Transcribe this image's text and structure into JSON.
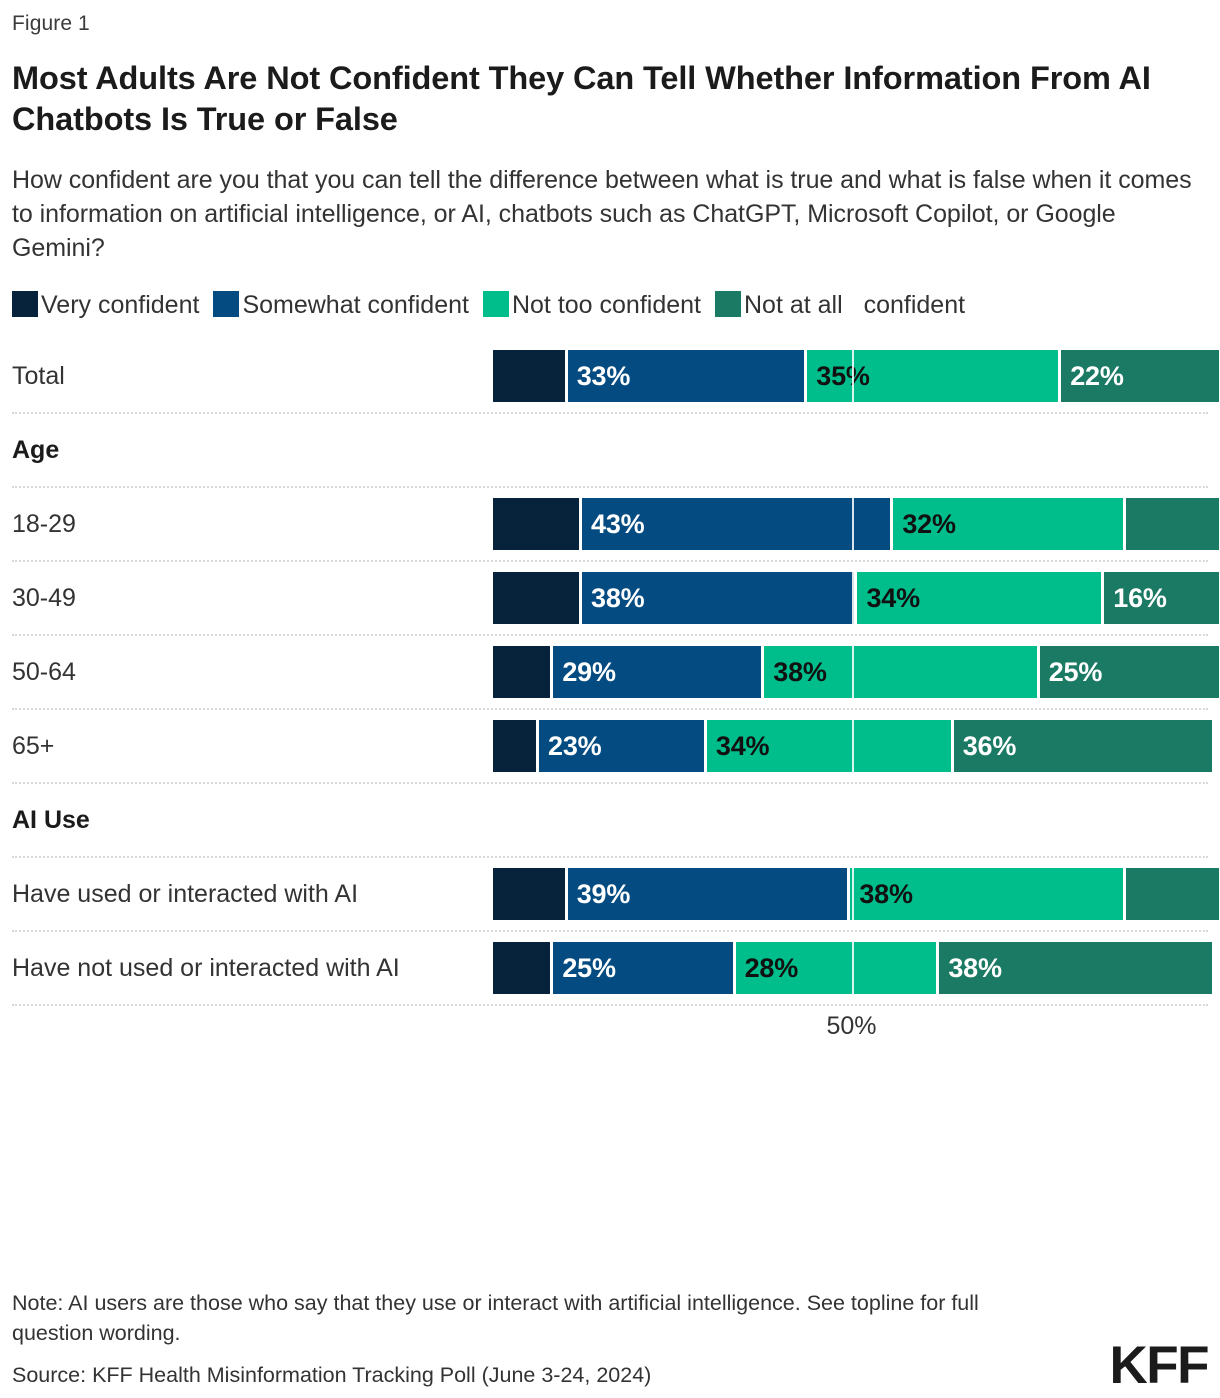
{
  "figure_label": "Figure 1",
  "title": "Most Adults Are Not Confident They Can Tell Whether Information From AI Chatbots Is True or False",
  "subtitle": "How confident are you that you can tell the difference between what is true and what is false when it comes to information on artificial intelligence, or AI, chatbots such as ChatGPT, Microsoft Copilot, or Google Gemini?",
  "legend": [
    {
      "label": "Very confident",
      "color": "#07233c"
    },
    {
      "label": "Somewhat confident",
      "color": "#034b81"
    },
    {
      "label": "Not too confident",
      "color": "#00bd8c"
    },
    {
      "label": "Not at all confident",
      "color": "#1a7a63"
    }
  ],
  "axis": {
    "tick_label": "50%",
    "tick_value": 50
  },
  "footer": {
    "note": "Note: AI users are those who say that they use or interact with artificial intelligence. See topline for full question wording.",
    "source": "Source: KFF Health Misinformation Tracking Poll (June 3-24, 2024)",
    "logo": "KFF"
  },
  "chart_data": {
    "type": "bar",
    "orientation": "horizontal",
    "stacked": true,
    "percent": true,
    "title": "Most Adults Are Not Confident They Can Tell Whether Information From AI Chatbots Is True or False",
    "subtitle": "How confident are you that you can tell the difference between what is true and what is false when it comes to information on artificial intelligence, or AI, chatbots such as ChatGPT, Microsoft Copilot, or Google Gemini?",
    "xlabel": "",
    "ylabel": "",
    "xlim": [
      0,
      100
    ],
    "xticks": [
      50
    ],
    "xtick_labels": [
      "50%"
    ],
    "grid": true,
    "legend_position": "top",
    "series": [
      {
        "name": "Very confident",
        "color": "#07233c",
        "values": [
          10,
          12,
          12,
          8,
          6,
          10,
          8
        ]
      },
      {
        "name": "Somewhat confident",
        "color": "#034b81",
        "values": [
          33,
          43,
          38,
          29,
          23,
          39,
          25
        ]
      },
      {
        "name": "Not too confident",
        "color": "#00bd8c",
        "values": [
          35,
          32,
          34,
          38,
          34,
          38,
          28
        ]
      },
      {
        "name": "Not at all confident",
        "color": "#1a7a63",
        "values": [
          22,
          13,
          16,
          25,
          36,
          13,
          38
        ]
      }
    ],
    "categories": [
      "Total",
      "18-29",
      "30-49",
      "50-64",
      "65+",
      "Have used or interacted with AI",
      "Have not used or interacted with AI"
    ]
  },
  "rows": [
    {
      "type": "bar",
      "label": "Total",
      "segments": [
        {
          "series": "Very confident",
          "value": 10,
          "display": "",
          "color": "#07233c",
          "text_color": "#ffffff"
        },
        {
          "series": "Somewhat confident",
          "value": 33,
          "display": "33%",
          "color": "#034b81",
          "text_color": "#ffffff"
        },
        {
          "series": "Not too confident",
          "value": 35,
          "display": "35%",
          "color": "#00bd8c",
          "text_color": "#111111"
        },
        {
          "series": "Not at all confident",
          "value": 22,
          "display": "22%",
          "color": "#1a7a63",
          "text_color": "#ffffff"
        }
      ]
    },
    {
      "type": "group",
      "label": "Age"
    },
    {
      "type": "bar",
      "label": "18-29",
      "segments": [
        {
          "series": "Very confident",
          "value": 12,
          "display": "",
          "color": "#07233c",
          "text_color": "#ffffff"
        },
        {
          "series": "Somewhat confident",
          "value": 43,
          "display": "43%",
          "color": "#034b81",
          "text_color": "#ffffff"
        },
        {
          "series": "Not too confident",
          "value": 32,
          "display": "32%",
          "color": "#00bd8c",
          "text_color": "#111111"
        },
        {
          "series": "Not at all confident",
          "value": 13,
          "display": "",
          "color": "#1a7a63",
          "text_color": "#ffffff"
        }
      ]
    },
    {
      "type": "bar",
      "label": "30-49",
      "segments": [
        {
          "series": "Very confident",
          "value": 12,
          "display": "",
          "color": "#07233c",
          "text_color": "#ffffff"
        },
        {
          "series": "Somewhat confident",
          "value": 38,
          "display": "38%",
          "color": "#034b81",
          "text_color": "#ffffff"
        },
        {
          "series": "Not too confident",
          "value": 34,
          "display": "34%",
          "color": "#00bd8c",
          "text_color": "#111111"
        },
        {
          "series": "Not at all confident",
          "value": 16,
          "display": "16%",
          "color": "#1a7a63",
          "text_color": "#ffffff"
        }
      ]
    },
    {
      "type": "bar",
      "label": "50-64",
      "segments": [
        {
          "series": "Very confident",
          "value": 8,
          "display": "",
          "color": "#07233c",
          "text_color": "#ffffff"
        },
        {
          "series": "Somewhat confident",
          "value": 29,
          "display": "29%",
          "color": "#034b81",
          "text_color": "#ffffff"
        },
        {
          "series": "Not too confident",
          "value": 38,
          "display": "38%",
          "color": "#00bd8c",
          "text_color": "#111111"
        },
        {
          "series": "Not at all confident",
          "value": 25,
          "display": "25%",
          "color": "#1a7a63",
          "text_color": "#ffffff"
        }
      ]
    },
    {
      "type": "bar",
      "label": "65+",
      "segments": [
        {
          "series": "Very confident",
          "value": 6,
          "display": "",
          "color": "#07233c",
          "text_color": "#ffffff"
        },
        {
          "series": "Somewhat confident",
          "value": 23,
          "display": "23%",
          "color": "#034b81",
          "text_color": "#ffffff"
        },
        {
          "series": "Not too confident",
          "value": 34,
          "display": "34%",
          "color": "#00bd8c",
          "text_color": "#111111"
        },
        {
          "series": "Not at all confident",
          "value": 36,
          "display": "36%",
          "color": "#1a7a63",
          "text_color": "#ffffff"
        }
      ]
    },
    {
      "type": "group",
      "label": "AI Use"
    },
    {
      "type": "bar",
      "label": "Have used or interacted with AI",
      "segments": [
        {
          "series": "Very confident",
          "value": 10,
          "display": "",
          "color": "#07233c",
          "text_color": "#ffffff"
        },
        {
          "series": "Somewhat confident",
          "value": 39,
          "display": "39%",
          "color": "#034b81",
          "text_color": "#ffffff"
        },
        {
          "series": "Not too confident",
          "value": 38,
          "display": "38%",
          "color": "#00bd8c",
          "text_color": "#111111"
        },
        {
          "series": "Not at all confident",
          "value": 13,
          "display": "",
          "color": "#1a7a63",
          "text_color": "#ffffff"
        }
      ]
    },
    {
      "type": "bar",
      "label": "Have not used or interacted with AI",
      "segments": [
        {
          "series": "Very confident",
          "value": 8,
          "display": "",
          "color": "#07233c",
          "text_color": "#ffffff"
        },
        {
          "series": "Somewhat confident",
          "value": 25,
          "display": "25%",
          "color": "#034b81",
          "text_color": "#ffffff"
        },
        {
          "series": "Not too confident",
          "value": 28,
          "display": "28%",
          "color": "#00bd8c",
          "text_color": "#111111"
        },
        {
          "series": "Not at all confident",
          "value": 38,
          "display": "38%",
          "color": "#1a7a63",
          "text_color": "#ffffff"
        }
      ]
    }
  ]
}
